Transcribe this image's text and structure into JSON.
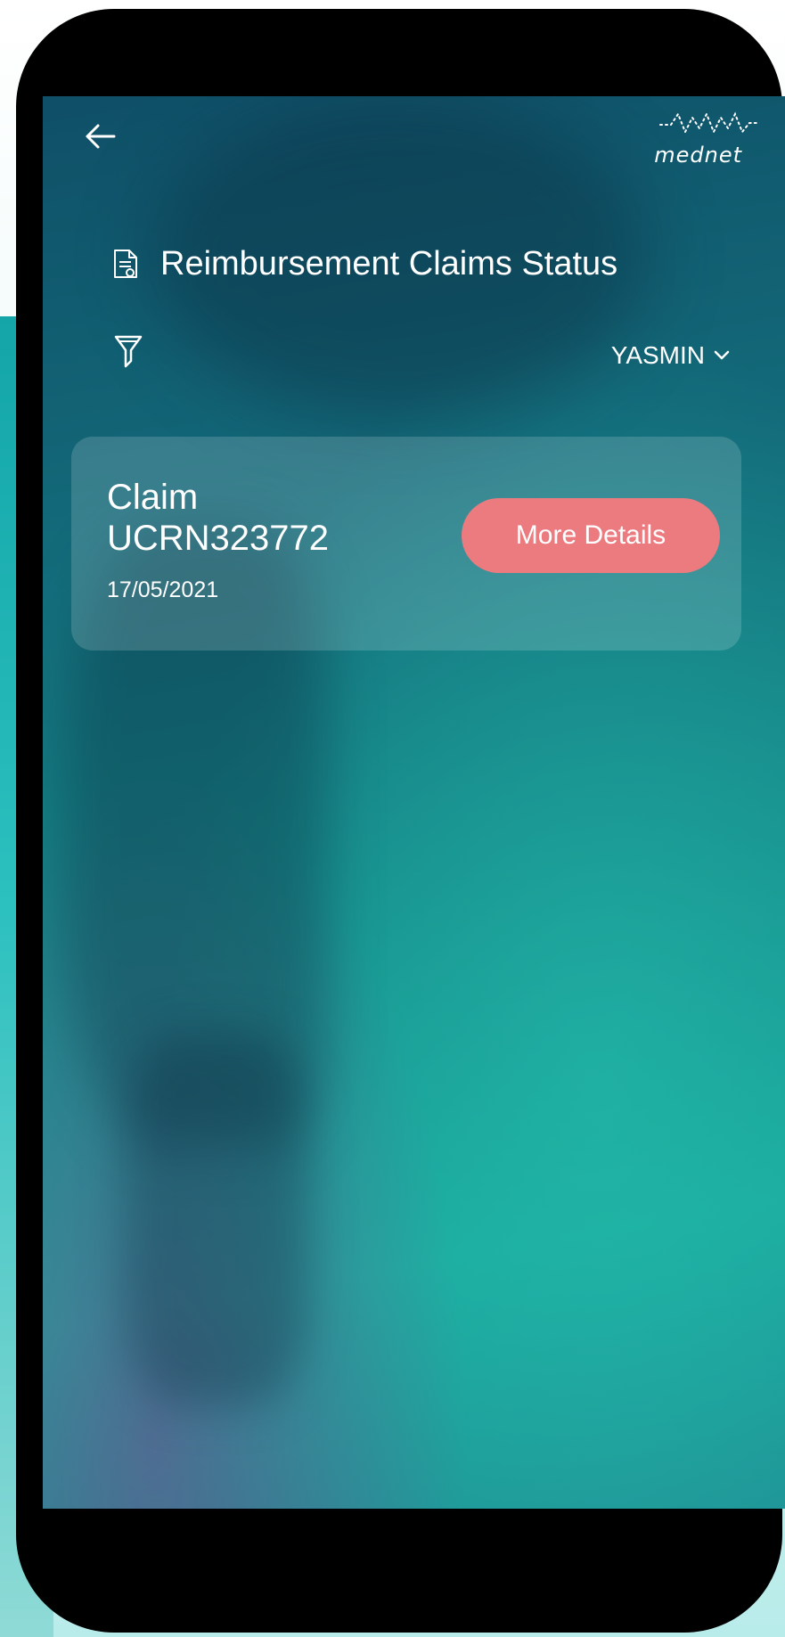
{
  "brand": {
    "logo_text": "mednet"
  },
  "header": {
    "back_icon": "arrow-left-icon",
    "title": "Reimbursement Claims Status",
    "title_icon": "document-icon"
  },
  "filters": {
    "filter_icon": "filter-icon",
    "member_selected": "YASMIN"
  },
  "claims": [
    {
      "title": "Claim",
      "id": "UCRN323772",
      "date": "17/05/2021",
      "action_label": "More Details"
    }
  ],
  "colors": {
    "accent_button": "#ec7b80",
    "screen_top": "#0f4f67",
    "screen_bottom": "#1aa79c"
  }
}
